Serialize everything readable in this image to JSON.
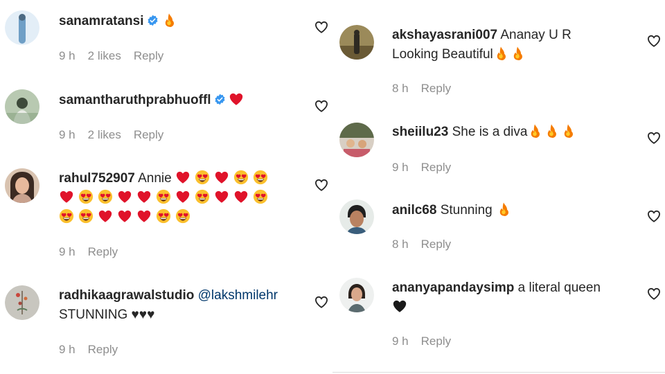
{
  "left_comments": [
    {
      "username": "sanamratansi",
      "text": "",
      "time": "9 h",
      "likes": "2 likes",
      "reply": "Reply",
      "verified": true
    },
    {
      "username": "samantharuthprabhuoffl",
      "text": "",
      "time": "9 h",
      "likes": "2 likes",
      "reply": "Reply",
      "verified": true
    },
    {
      "username": "rahul752907",
      "text": "Annie",
      "time": "9 h",
      "reply": "Reply"
    },
    {
      "username": "radhikaagrawalstudio",
      "mention": "@lakshmilehr",
      "text": "STUNNING ♥♥♥",
      "time": "9 h",
      "reply": "Reply"
    }
  ],
  "right_comments": [
    {
      "username": "akshayasrani007",
      "text": "Ananay U R",
      "text2": "Looking Beautiful",
      "time": "8 h",
      "reply": "Reply"
    },
    {
      "username": "sheiilu23",
      "text": "She is a diva",
      "time": "9 h",
      "reply": "Reply"
    },
    {
      "username": "anilc68",
      "text": "Stunning",
      "time": "8 h",
      "reply": "Reply"
    },
    {
      "username": "ananyapandaysimp",
      "text": "a literal queen",
      "time": "9 h",
      "reply": "Reply"
    }
  ],
  "colors": {
    "verified": "#3897f0",
    "meta": "#8e8e8e",
    "mention": "#00376b",
    "heart_red": "#e0132a",
    "fire": "#f77c1b"
  },
  "icons": [
    "verified-badge-icon",
    "fire-emoji-icon",
    "red-heart-emoji-icon",
    "heart-eyes-emoji-icon",
    "black-heart-emoji-icon",
    "like-heart-outline-icon"
  ]
}
